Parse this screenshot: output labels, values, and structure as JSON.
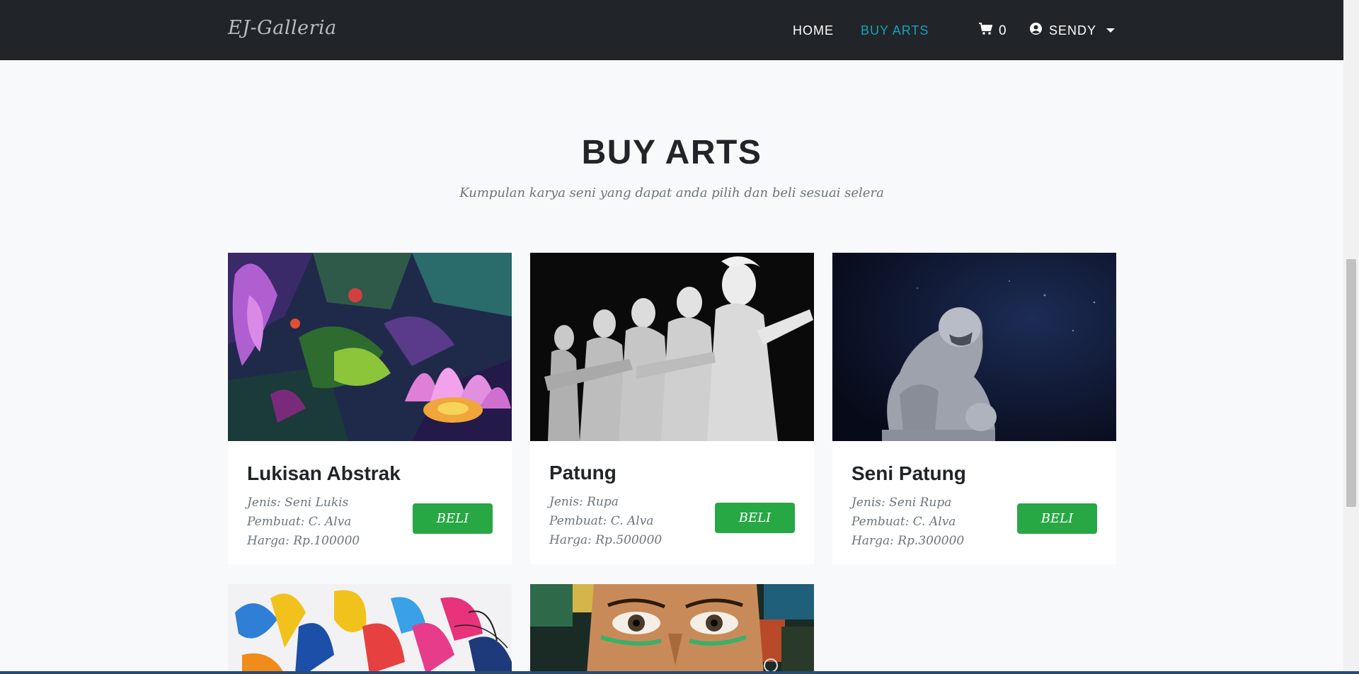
{
  "navbar": {
    "brand": "EJ-Galleria",
    "links": [
      {
        "label": "HOME",
        "active": false
      },
      {
        "label": "BUY ARTS",
        "active": true
      }
    ],
    "cart_count": "0",
    "user_name": "SENDY",
    "accent_color": "#17a2b8",
    "icons": [
      "shopping-cart-icon",
      "user-circle-icon",
      "caret-down-icon"
    ]
  },
  "header": {
    "title": "BUY ARTS",
    "subtitle": "Kumpulan karya seni yang dapat anda pilih dan beli sesuai selera"
  },
  "products": [
    {
      "title": "Lukisan Abstrak",
      "jenis": "Jenis: Seni Lukis",
      "pembuat": "Pembuat: C. Alva",
      "harga": "Harga: Rp.100000",
      "button": "BELI"
    },
    {
      "title": "Patung",
      "jenis": "Jenis: Rupa",
      "pembuat": "Pembuat: C. Alva",
      "harga": "Harga: Rp.500000",
      "button": "BELI"
    },
    {
      "title": "Seni Patung",
      "jenis": "Jenis: Seni Rupa",
      "pembuat": "Pembuat: C. Alva",
      "harga": "Harga: Rp.300000",
      "button": "BELI"
    }
  ],
  "colors": {
    "button_green": "#28a745",
    "navbar_bg": "#212529",
    "page_bg": "#f8f9fa"
  }
}
